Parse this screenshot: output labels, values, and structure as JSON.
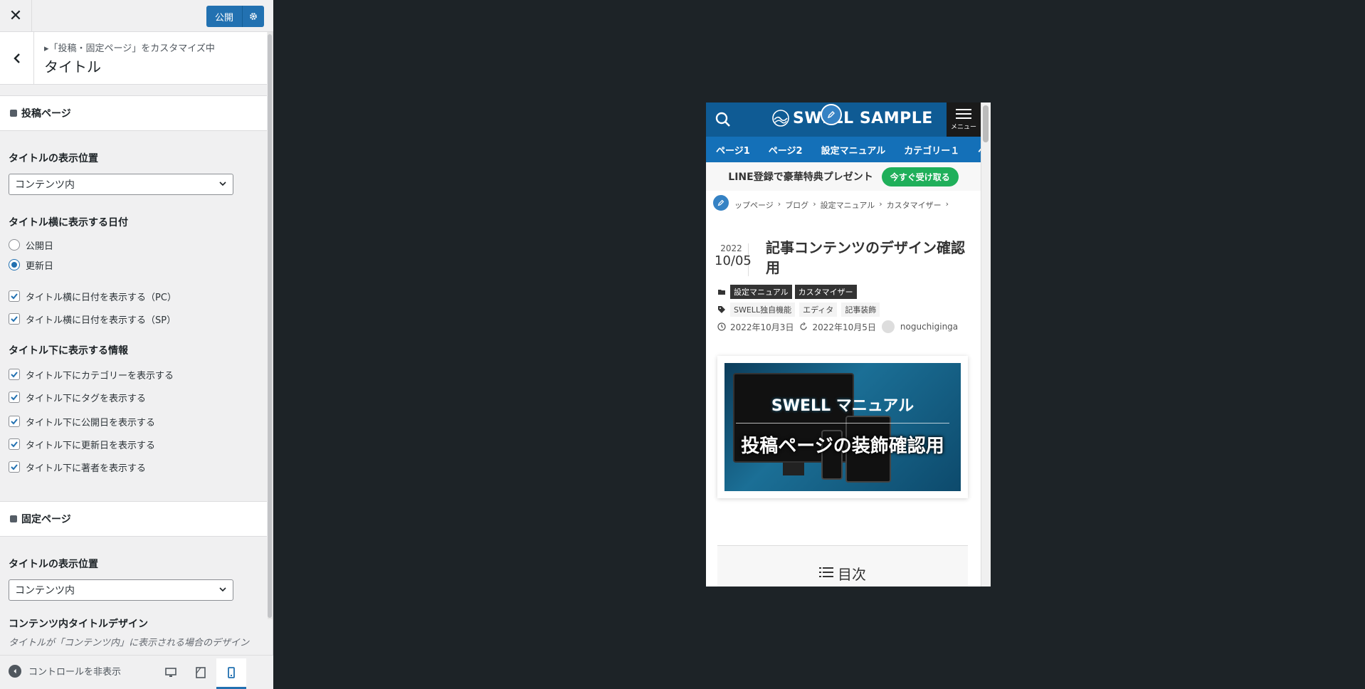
{
  "header": {
    "close_label": "✕",
    "publish_label": "公開",
    "publish_settings_icon": "gear-icon"
  },
  "section": {
    "breadcrumb": "▸「投稿・固定ページ」をカスタマイズ中",
    "title": "タイトル"
  },
  "post_group": {
    "title": "投稿ページ",
    "position_label": "タイトルの表示位置",
    "position_value": "コンテンツ内",
    "date_label": "タイトル横に表示する日付",
    "date_options": [
      "公開日",
      "更新日"
    ],
    "date_selected": "更新日",
    "side_checks": [
      {
        "label": "タイトル横に日付を表示する（PC）",
        "checked": true
      },
      {
        "label": "タイトル横に日付を表示する（SP）",
        "checked": true
      }
    ],
    "info_label": "タイトル下に表示する情報",
    "info_checks": [
      {
        "label": "タイトル下にカテゴリーを表示する",
        "checked": true
      },
      {
        "label": "タイトル下にタグを表示する",
        "checked": true
      },
      {
        "label": "タイトル下に公開日を表示する",
        "checked": true
      },
      {
        "label": "タイトル下に更新日を表示する",
        "checked": true
      },
      {
        "label": "タイトル下に著者を表示する",
        "checked": true
      }
    ]
  },
  "page_group": {
    "title": "固定ページ",
    "position_label": "タイトルの表示位置",
    "position_value": "コンテンツ内",
    "design_label": "コンテンツ内タイトルデザイン",
    "design_desc": "タイトルが「コンテンツ内」に表示される場合のデザイン"
  },
  "footer": {
    "collapse_label": "コントロールを非表示",
    "devices": [
      "desktop-icon",
      "tablet-icon",
      "mobile-icon"
    ],
    "active_device": "mobile-icon"
  },
  "preview": {
    "logo_text": "SWELL SAMPLE",
    "menu_label": "メニュー",
    "nav": [
      "ページ1",
      "ページ2",
      "設定マニュアル",
      "カテゴリー１",
      "ペー"
    ],
    "promo_text": "LINE登録で豪華特典プレゼント",
    "promo_button": "今すぐ受け取る",
    "breadcrumbs": [
      "ップページ",
      "›",
      "ブログ",
      "›",
      "設定マニュアル",
      "›",
      "カスタマイザー",
      "›"
    ],
    "date_year": "2022",
    "date_md": "10/05",
    "post_title": "記事コンテンツのデザイン確認用",
    "categories": [
      "設定マニュアル",
      "カスタマイザー"
    ],
    "tags": [
      "SWELL独自機能",
      "エディタ",
      "記事装飾"
    ],
    "published": "2022年10月3日",
    "updated": "2022年10月5日",
    "author": "noguchiginga",
    "thumb_title": "SWELL マニュアル",
    "thumb_subtitle": "投稿ページの装飾確認用",
    "toc_label": "目次"
  },
  "colors": {
    "accent": "#2271b1",
    "header_bg": "#0f5b94",
    "nav_bg": "#1470b8",
    "promo_button": "#1faf5a",
    "backdrop": "#1d2327"
  }
}
